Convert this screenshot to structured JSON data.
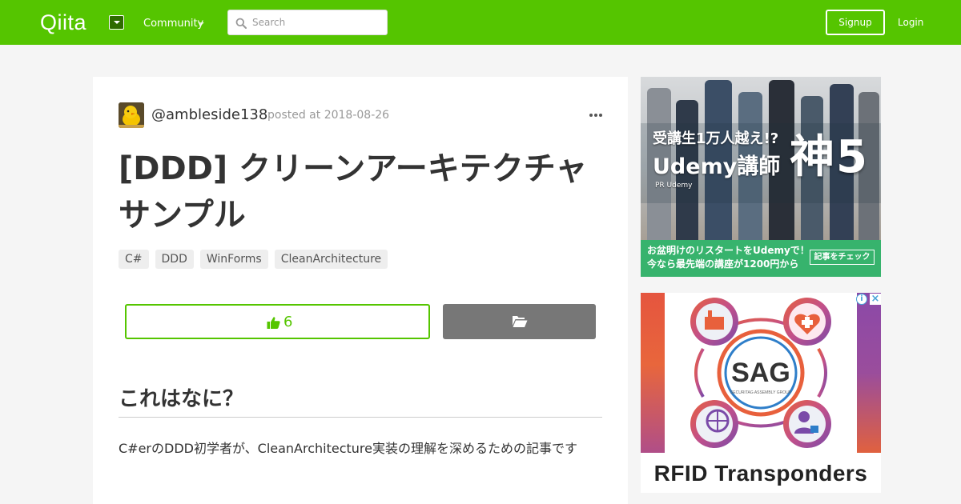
{
  "header": {
    "logo": "Qiita",
    "community_label": "Community",
    "search": {
      "placeholder": "Search"
    },
    "signup_label": "Signup",
    "login_label": "Login",
    "brand_color": "#55c500"
  },
  "article": {
    "author": "@ambleside138",
    "posted": "posted at 2018-08-26",
    "title": "[DDD] クリーンアーキテクチャサンプル",
    "tags": [
      "C#",
      "DDD",
      "WinForms",
      "CleanArchitecture"
    ],
    "like_count": "6",
    "heading": "これはなに？",
    "paragraph": "C#erのDDD初学者が、CleanArchitecture実装の理解を深めるための記事です"
  },
  "ads": {
    "ad1": {
      "line1": "受講生1万人越え!?",
      "line2": "Udemy講師",
      "big": "神5",
      "pr": "PR Udemy",
      "bar_line1": "お盆明けのリスタートをUdemyで！",
      "bar_line2": "今なら最先端の講座が1200円から",
      "check_label": "記事をチェック"
    },
    "ad2": {
      "info": "i",
      "close": "×",
      "logo_text": "SAG",
      "logo_subtext": "SECURITAG ASSEMBLY GROUP",
      "caption": "RFID  Transponders"
    }
  }
}
